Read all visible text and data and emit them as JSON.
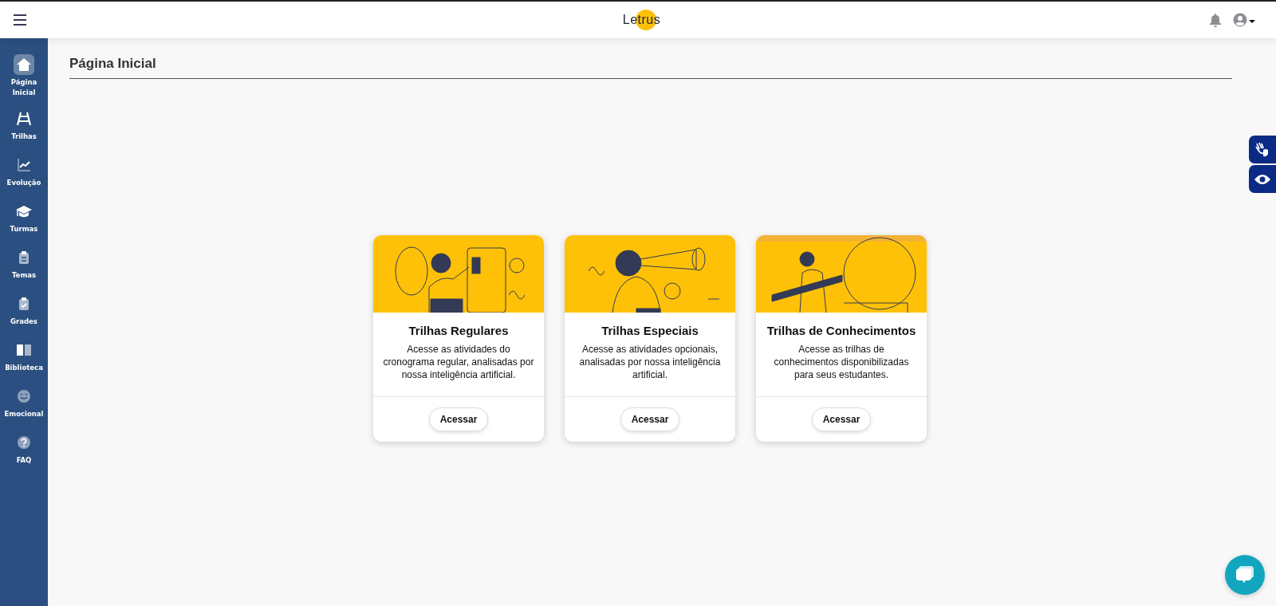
{
  "header": {
    "logo": "Letrus"
  },
  "sidebar": {
    "items": [
      {
        "label": "Página Inicial",
        "selected": true
      },
      {
        "label": "Trilhas",
        "selected": false
      },
      {
        "label": "Evolução",
        "selected": false
      },
      {
        "label": "Turmas",
        "selected": false
      },
      {
        "label": "Temas",
        "selected": false
      },
      {
        "label": "Grades",
        "selected": false
      },
      {
        "label": "Biblioteca",
        "selected": false
      },
      {
        "label": "Emocional",
        "selected": false
      },
      {
        "label": "FAQ",
        "selected": false
      }
    ]
  },
  "page": {
    "title": "Página Inicial"
  },
  "cards": [
    {
      "title": "Trilhas Regulares",
      "description": "Acesse as atividades do cronograma regular, analisadas por nossa inteligência artificial.",
      "button": "Acessar"
    },
    {
      "title": "Trilhas Especiais",
      "description": "Acesse as atividades opcionais, analisadas por nossa inteligência artificial.",
      "button": "Acessar"
    },
    {
      "title": "Trilhas de Conhecimentos",
      "description": "Acesse as trilhas de conhecimentos disponibilizadas para seus estudantes.",
      "button": "Acessar"
    }
  ]
}
